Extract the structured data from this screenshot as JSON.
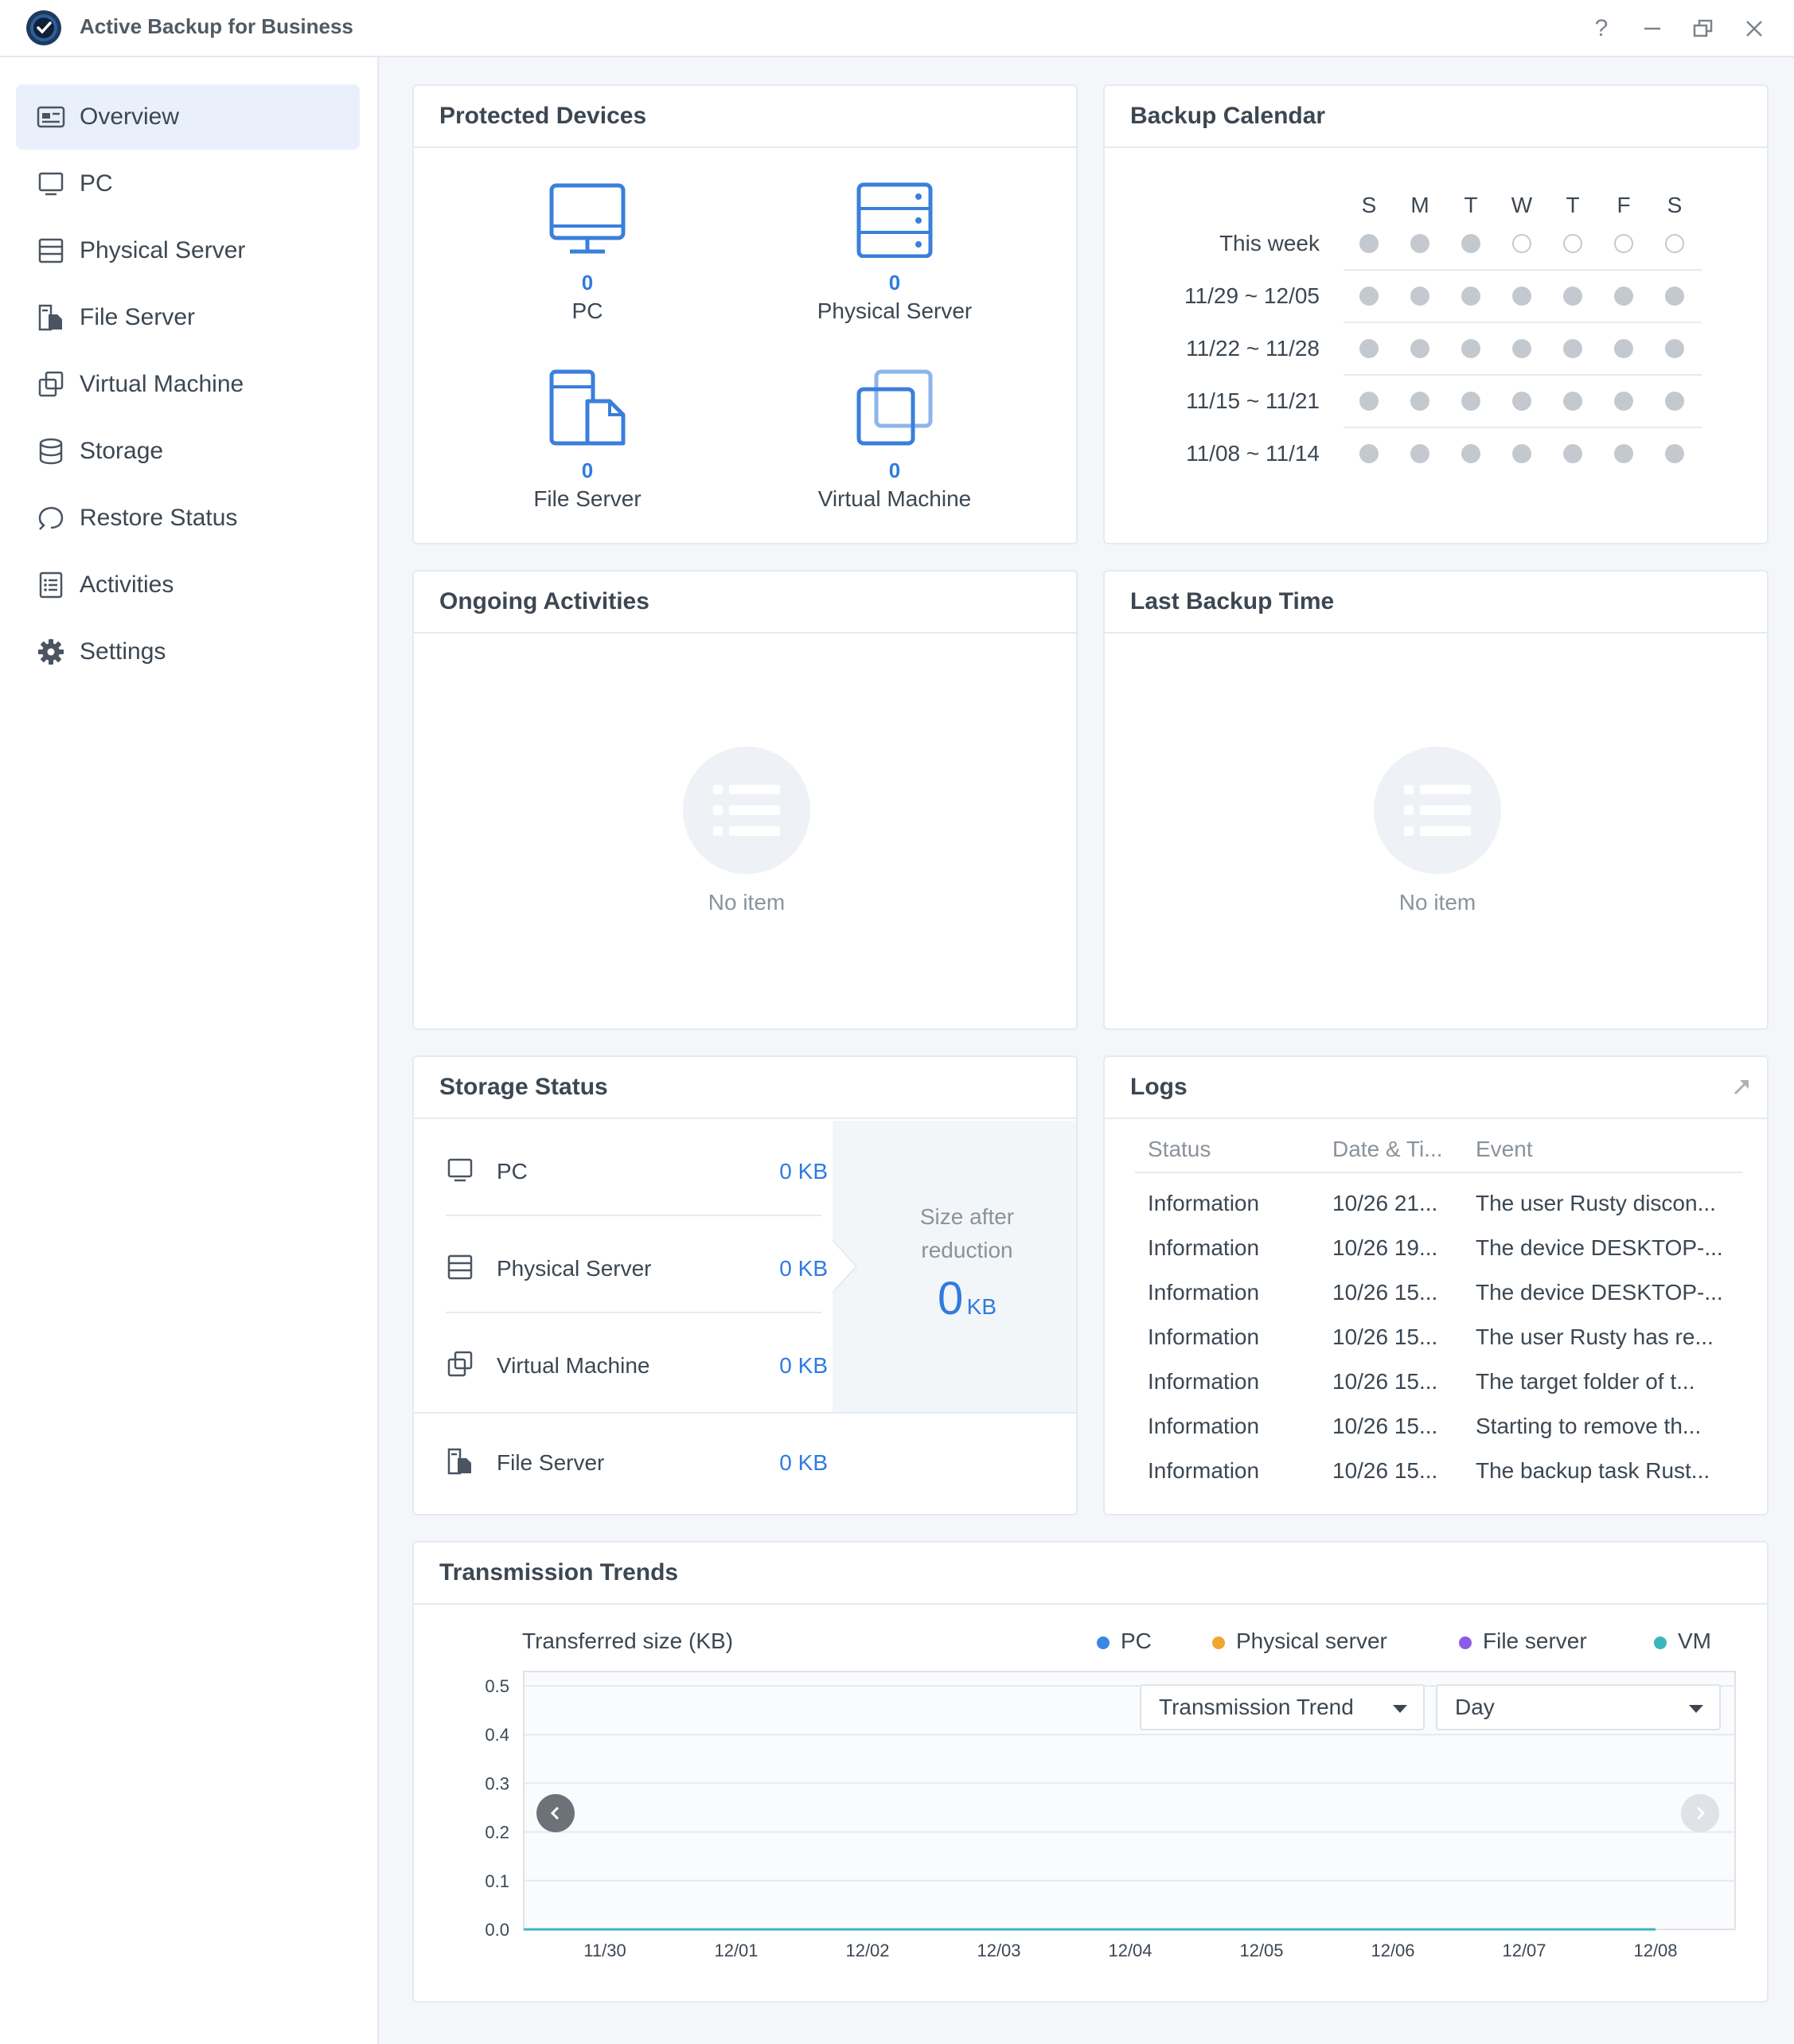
{
  "window": {
    "title": "Active Backup for Business",
    "buttons": [
      "?",
      "–",
      "□",
      "×"
    ]
  },
  "sidebar": {
    "items": [
      {
        "label": "Overview",
        "icon": "overview-icon",
        "active": true
      },
      {
        "label": "PC",
        "icon": "pc-icon"
      },
      {
        "label": "Physical Server",
        "icon": "physical-server-icon"
      },
      {
        "label": "File Server",
        "icon": "file-server-icon"
      },
      {
        "label": "Virtual Machine",
        "icon": "virtual-machine-icon"
      },
      {
        "label": "Storage",
        "icon": "storage-icon"
      },
      {
        "label": "Restore Status",
        "icon": "restore-status-icon"
      },
      {
        "label": "Activities",
        "icon": "activities-icon"
      },
      {
        "label": "Settings",
        "icon": "gear-icon"
      }
    ]
  },
  "protected_devices": {
    "title": "Protected Devices",
    "devices": [
      {
        "label": "PC",
        "count": "0"
      },
      {
        "label": "Physical Server",
        "count": "0"
      },
      {
        "label": "File Server",
        "count": "0"
      },
      {
        "label": "Virtual Machine",
        "count": "0"
      }
    ]
  },
  "backup_calendar": {
    "title": "Backup Calendar",
    "days": [
      "S",
      "M",
      "T",
      "W",
      "T",
      "F",
      "S"
    ],
    "rows": [
      {
        "label": "This week",
        "filled": [
          true,
          true,
          true,
          false,
          false,
          false,
          false
        ]
      },
      {
        "label": "11/29 ~ 12/05",
        "filled": [
          true,
          true,
          true,
          true,
          true,
          true,
          true
        ]
      },
      {
        "label": "11/22 ~ 11/28",
        "filled": [
          true,
          true,
          true,
          true,
          true,
          true,
          true
        ]
      },
      {
        "label": "11/15 ~ 11/21",
        "filled": [
          true,
          true,
          true,
          true,
          true,
          true,
          true
        ]
      },
      {
        "label": "11/08 ~ 11/14",
        "filled": [
          true,
          true,
          true,
          true,
          true,
          true,
          true
        ]
      }
    ]
  },
  "ongoing_activities": {
    "title": "Ongoing Activities",
    "empty_text": "No item"
  },
  "last_backup_time": {
    "title": "Last Backup Time",
    "empty_text": "No item"
  },
  "storage_status": {
    "title": "Storage Status",
    "rows": [
      {
        "label": "PC",
        "value": "0 KB"
      },
      {
        "label": "Physical Server",
        "value": "0 KB"
      },
      {
        "label": "Virtual Machine",
        "value": "0 KB"
      },
      {
        "label": "File Server",
        "value": "0 KB"
      }
    ],
    "reduction_label_1": "Size after",
    "reduction_label_2": "reduction",
    "reduction_value": "0",
    "reduction_unit": "KB"
  },
  "logs": {
    "title": "Logs",
    "columns": [
      "Status",
      "Date & Ti...",
      "Event"
    ],
    "rows": [
      [
        "Information",
        "10/26 21...",
        "The user Rusty discon..."
      ],
      [
        "Information",
        "10/26 19...",
        "The device DESKTOP-..."
      ],
      [
        "Information",
        "10/26 15...",
        "The device DESKTOP-..."
      ],
      [
        "Information",
        "10/26 15...",
        "The user Rusty has re..."
      ],
      [
        "Information",
        "10/26 15...",
        "The target folder of t..."
      ],
      [
        "Information",
        "10/26 15...",
        "Starting to remove th..."
      ],
      [
        "Information",
        "10/26 15...",
        "The backup task Rust..."
      ]
    ]
  },
  "transmission_trends": {
    "title": "Transmission Trends",
    "trend_select": "Transmission Trend",
    "period_select": "Day"
  },
  "chart_data": {
    "type": "line",
    "ylabel": "Transferred size (KB)",
    "categories": [
      "11/30",
      "12/01",
      "12/02",
      "12/03",
      "12/04",
      "12/05",
      "12/06",
      "12/07",
      "12/08"
    ],
    "yticks": [
      "0.5",
      "0.4",
      "0.3",
      "0.2",
      "0.1",
      "0.0"
    ],
    "ylim": [
      0,
      0.5
    ],
    "legend_position": "top-right",
    "series": [
      {
        "name": "PC",
        "color": "#3b86e6",
        "values": [
          0,
          0,
          0,
          0,
          0,
          0,
          0,
          0,
          0
        ]
      },
      {
        "name": "Physical server",
        "color": "#f0a630",
        "values": [
          0,
          0,
          0,
          0,
          0,
          0,
          0,
          0,
          0
        ]
      },
      {
        "name": "File server",
        "color": "#8b5ce6",
        "values": [
          0,
          0,
          0,
          0,
          0,
          0,
          0,
          0,
          0
        ]
      },
      {
        "name": "VM",
        "color": "#3ab7bc",
        "values": [
          0,
          0,
          0,
          0,
          0,
          0,
          0,
          0,
          0
        ]
      }
    ]
  }
}
